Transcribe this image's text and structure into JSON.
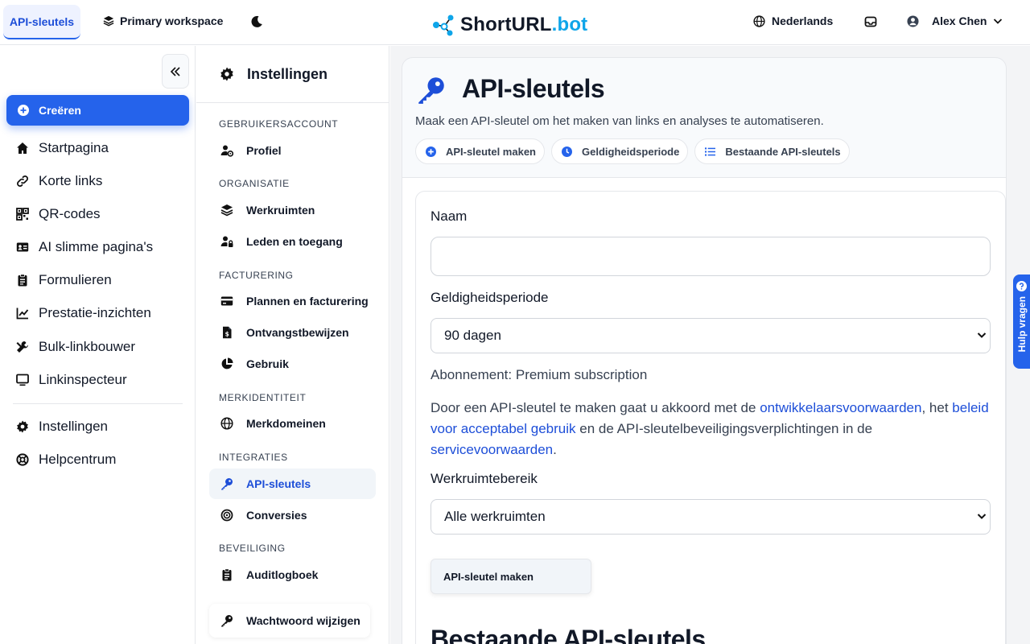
{
  "topbar": {
    "active_tab": "API-sleutels",
    "workspace": "Primary workspace",
    "logo_main": "ShortURL",
    "logo_suffix": ".bot",
    "language": "Nederlands",
    "user_name": "Alex Chen"
  },
  "sidebar": {
    "create_label": "Creëren",
    "items": [
      {
        "label": "Startpagina",
        "icon": "home-icon"
      },
      {
        "label": "Korte links",
        "icon": "link-icon"
      },
      {
        "label": "QR-codes",
        "icon": "qr-icon"
      },
      {
        "label": "AI slimme pagina's",
        "icon": "id-card-icon"
      },
      {
        "label": "Formulieren",
        "icon": "clipboard-icon"
      },
      {
        "label": "Prestatie-inzichten",
        "icon": "chart-line-icon"
      },
      {
        "label": "Bulk-linkbouwer",
        "icon": "tools-icon"
      },
      {
        "label": "Linkinspecteur",
        "icon": "monitor-icon"
      }
    ],
    "bottom_items": [
      {
        "label": "Instellingen",
        "icon": "gear-icon"
      },
      {
        "label": "Helpcentrum",
        "icon": "lifebuoy-icon"
      }
    ]
  },
  "settings": {
    "title": "Instellingen",
    "sections": [
      {
        "title": "GEBRUIKERSACCOUNT",
        "items": [
          "Profiel"
        ]
      },
      {
        "title": "ORGANISATIE",
        "items": [
          "Werkruimten",
          "Leden en toegang"
        ]
      },
      {
        "title": "FACTURERING",
        "items": [
          "Plannen en facturering",
          "Ontvangstbewijzen",
          "Gebruik"
        ]
      },
      {
        "title": "MERKIDENTITEIT",
        "items": [
          "Merkdomeinen"
        ]
      },
      {
        "title": "INTEGRATIES",
        "items": [
          "API-sleutels",
          "Conversies"
        ]
      },
      {
        "title": "BEVEILIGING",
        "items": [
          "Auditlogboek"
        ]
      }
    ],
    "change_password": "Wachtwoord wijzigen"
  },
  "main": {
    "title": "API-sleutels",
    "subtitle": "Maak een API-sleutel om het maken van links en analyses te automatiseren.",
    "pills": [
      "API-sleutel maken",
      "Geldigheidsperiode",
      "Bestaande API-sleutels"
    ],
    "form": {
      "name_label": "Naam",
      "name_value": "",
      "validity_label": "Geldigheidsperiode",
      "validity_value": "90 dagen",
      "subscription": "Abonnement: Premium subscription",
      "terms_1": "Door een API-sleutel te maken gaat u akkoord met de ",
      "terms_link_1": "ontwikkelaarsvoorwaarden",
      "terms_2": ", het ",
      "terms_link_2": "beleid voor acceptabel gebruik",
      "terms_3": " en de API-sleutelbeveiligingsverplichtingen in de ",
      "terms_link_3": "servicevoorwaarden",
      "terms_4": ".",
      "scope_label": "Werkruimtebereik",
      "scope_value": "Alle werkruimten",
      "submit_label": "API-sleutel maken"
    },
    "existing_title": "Bestaande API-sleutels"
  },
  "help_label": "Hulp vragen",
  "colors": {
    "accent": "#2563eb",
    "logo_suffix": "#0ea5e9",
    "active_text": "#1d4ed8"
  }
}
